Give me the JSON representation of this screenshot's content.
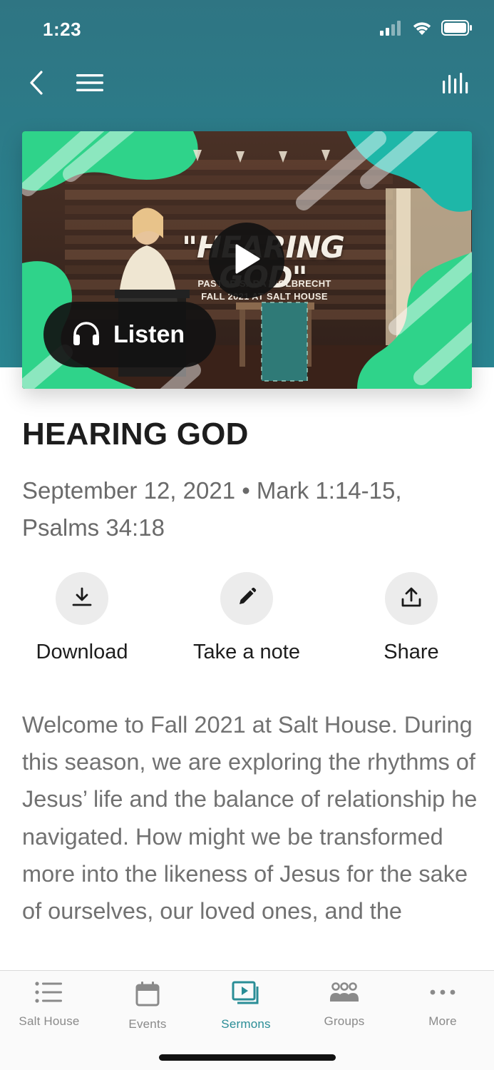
{
  "status_bar": {
    "time": "1:23",
    "icons": [
      "cellular-signal-icon",
      "wifi-icon",
      "battery-icon"
    ]
  },
  "nav": {
    "back_icon": "chevron-left-icon",
    "menu_icon": "hamburger-menu-icon",
    "audio_icon": "audio-bars-icon"
  },
  "video": {
    "thumb_title": "\"HEARING GOD\"",
    "thumb_subtitle_1": "PASTOR SARA WOLBRECHT",
    "thumb_subtitle_2": "FALL 2021 AT SALT HOUSE",
    "play_icon": "play-icon",
    "listen_label": "Listen",
    "listen_icon": "headphones-icon"
  },
  "sermon": {
    "title": "HEARING GOD",
    "meta": "September 12, 2021 • Mark 1:14-15, Psalms 34:18"
  },
  "actions": {
    "download_label": "Download",
    "note_label": "Take a note",
    "share_label": "Share"
  },
  "description": "Welcome to Fall 2021 at Salt House. During this season, we are exploring the rhythms of Jesus’ life and the balance of relationship he navigated. How might we be transformed more into the likeness of Jesus for the sake of ourselves, our loved ones, and the",
  "tab_bar": {
    "tabs": [
      {
        "label": "Salt House",
        "icon": "list-icon"
      },
      {
        "label": "Events",
        "icon": "calendar-icon"
      },
      {
        "label": "Sermons",
        "icon": "video-playlist-icon"
      },
      {
        "label": "Groups",
        "icon": "groups-icon"
      },
      {
        "label": "More",
        "icon": "more-dots-icon"
      }
    ],
    "active": "Sermons"
  },
  "colors": {
    "header": "#2a7f8c",
    "accent": "#2a8d96",
    "thumb_green": "#2fd38a"
  }
}
